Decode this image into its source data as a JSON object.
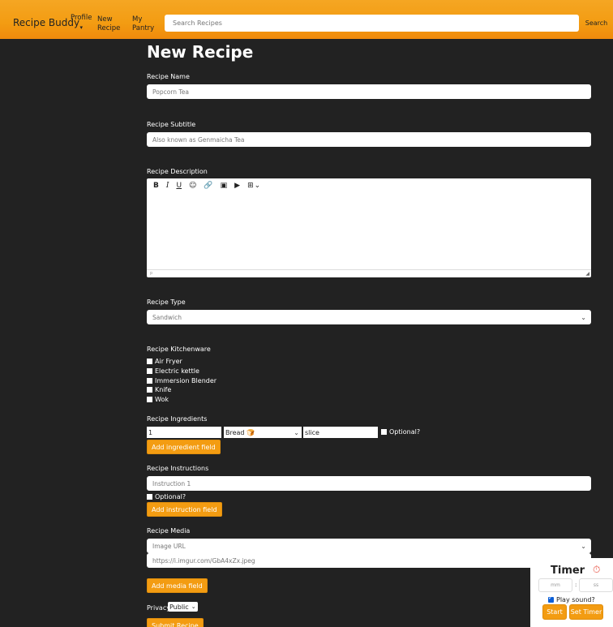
{
  "navbar": {
    "brand": "Recipe Buddy",
    "profile": "Profile",
    "profile_caret": "▾",
    "new_line1": "New",
    "new_line2": "Recipe",
    "pantry_line1": "My",
    "pantry_line2": "Pantry",
    "search_placeholder": "Search Recipes",
    "search_button": "Search"
  },
  "page": {
    "title": "New Recipe"
  },
  "recipe_name": {
    "label": "Recipe Name",
    "value": "Popcorn Tea"
  },
  "recipe_subtitle": {
    "label": "Recipe Subtitle",
    "placeholder": "Also known as Genmaicha Tea"
  },
  "recipe_description": {
    "label": "Recipe Description",
    "toolbar": [
      "B",
      "I",
      "U",
      "☺",
      "🔗",
      "▣",
      "▶",
      "⊞",
      "⌄"
    ],
    "status": "p"
  },
  "recipe_type": {
    "label": "Recipe Type",
    "selected": "Sandwich"
  },
  "kitchenware": {
    "label": "Recipe Kitchenware",
    "items": [
      "Air Fryer",
      "Electric kettle",
      "Immersion Blender",
      "Knife",
      "Wok"
    ]
  },
  "ingredients": {
    "label": "Recipe Ingredients",
    "row": {
      "quantity": "1",
      "ingredient": "Bread 🍞",
      "unit": "slice",
      "optional_label": "Optional?"
    },
    "add_button": "Add ingredient field"
  },
  "instructions": {
    "label": "Recipe Instructions",
    "placeholder": "Instruction 1",
    "optional_label": "Optional?",
    "add_button": "Add instruction field"
  },
  "media": {
    "label": "Recipe Media",
    "type_selected": "Image URL",
    "url_placeholder": "https://i.imgur.com/GbA4xZx.jpeg",
    "add_button": "Add media field"
  },
  "privacy": {
    "label": "Privacy",
    "selected": "Public"
  },
  "submit_button": "Submit Recipe",
  "timer": {
    "title": "Timer",
    "icon": "⏱",
    "mm_placeholder": "mm",
    "colon": ":",
    "ss_placeholder": "ss",
    "play_sound_label": "Play sound?",
    "start_button": "Start",
    "set_button": "Set Timer"
  }
}
